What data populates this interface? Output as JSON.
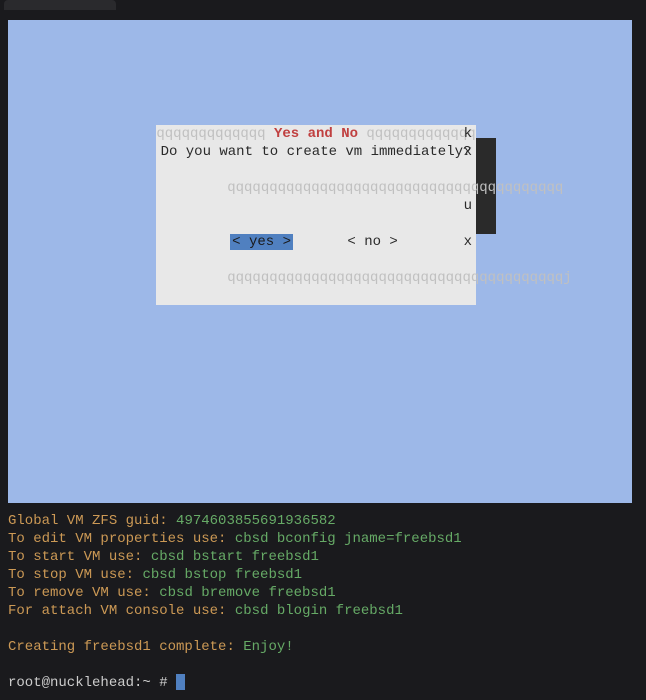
{
  "dialog": {
    "top_border": "qqqqqqqqqqqqq",
    "top_border_right": "qqqqqqqqqqqqq",
    "title": "Yes and No",
    "message": "Do you want to create vm immediately?",
    "separator": "qqqqqqqqqqqqqqqqqqqqqqqqqqqqqqqqqqqqqqqq",
    "yes_label": "< yes >",
    "no_label": "<  no  >",
    "bottom_border": "qqqqqqqqqqqqqqqqqqqqqqqqqqqqqqqqqqqqqqqqj",
    "side_k": "k",
    "side_x": "x",
    "side_u": "u"
  },
  "output": {
    "line1_label": "Global VM ZFS guid",
    "line1_value": "4974603855691936582",
    "line2_label": "To edit VM properties use",
    "line2_value": "cbsd bconfig jname=freebsd1",
    "line3_label": "To start VM use",
    "line3_value": "cbsd bstart freebsd1",
    "line4_label": "To stop VM use",
    "line4_value": "cbsd bstop freebsd1",
    "line5_label": "To remove VM use",
    "line5_value": "cbsd bremove freebsd1",
    "line6_label": "For attach VM console use",
    "line6_value": "cbsd blogin freebsd1",
    "line7_label": "Creating freebsd1 complete",
    "line7_value": "Enjoy!",
    "prompt": "root@nucklehead:~ # "
  }
}
